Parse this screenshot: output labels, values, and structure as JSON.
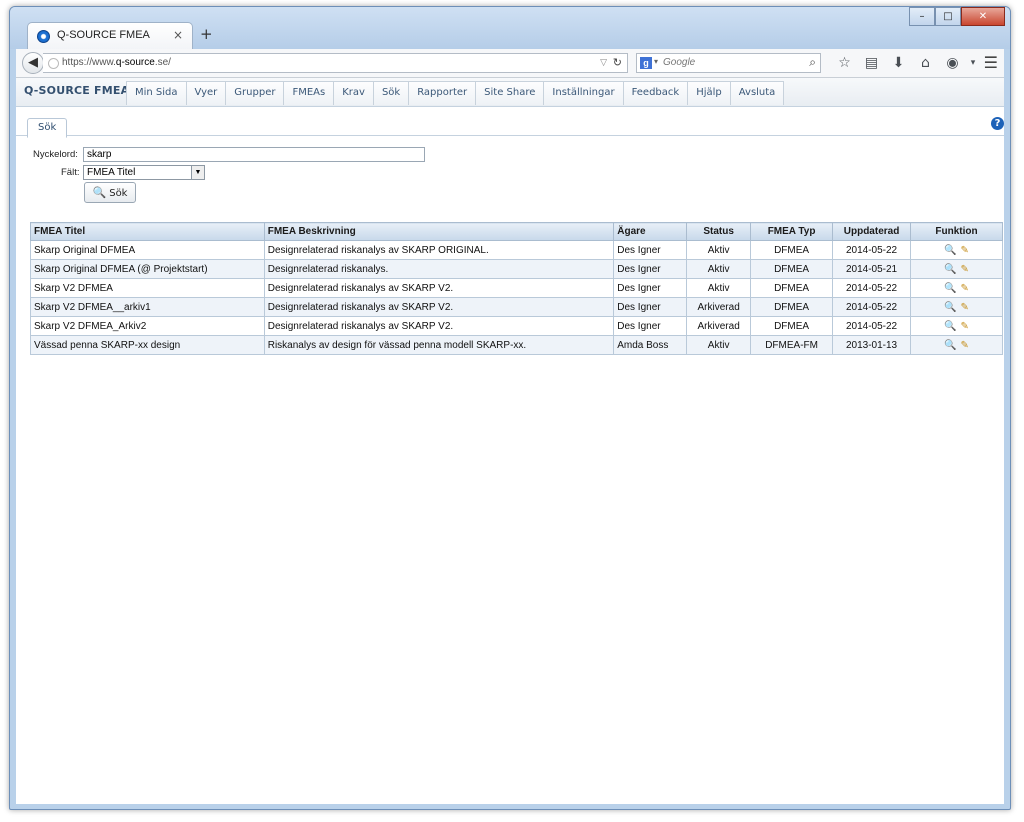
{
  "browser": {
    "tab_title": "Q-SOURCE FMEA",
    "tab_close": "×",
    "new_tab": "+",
    "win_min": "–",
    "win_max": "□",
    "win_close": "✕",
    "url_prefix": "https://www.",
    "url_domain": "q-source",
    "url_suffix": ".se/",
    "search_placeholder": "Google",
    "icons": [
      "star-icon",
      "clipboard-icon",
      "download-icon",
      "home-icon",
      "sync-icon",
      "menu-icon"
    ]
  },
  "app": {
    "brand": "Q-SOURCE FMEA",
    "nav": [
      "Min Sida",
      "Vyer",
      "Grupper",
      "FMEAs",
      "Krav",
      "Sök",
      "Rapporter",
      "Site Share",
      "Inställningar",
      "Feedback",
      "Hjälp",
      "Avsluta"
    ],
    "subtab": "Sök"
  },
  "search_form": {
    "keyword_label": "Nyckelord:",
    "keyword_value": "skarp",
    "field_label": "Fält:",
    "field_value": "FMEA Titel",
    "button_label": "Sök"
  },
  "table": {
    "headers": [
      "FMEA Titel",
      "FMEA Beskrivning",
      "Ägare",
      "Status",
      "FMEA Typ",
      "Uppdaterad",
      "Funktion"
    ],
    "rows": [
      {
        "title": "Skarp Original DFMEA",
        "desc": "Designrelaterad riskanalys av SKARP ORIGINAL.",
        "owner": "Des Igner",
        "status": "Aktiv",
        "type": "DFMEA",
        "updated": "2014-05-22"
      },
      {
        "title": "Skarp Original DFMEA (@ Projektstart)",
        "desc": "Designrelaterad riskanalys.",
        "owner": "Des Igner",
        "status": "Aktiv",
        "type": "DFMEA",
        "updated": "2014-05-21"
      },
      {
        "title": "Skarp V2 DFMEA",
        "desc": "Designrelaterad riskanalys av SKARP V2.",
        "owner": "Des Igner",
        "status": "Aktiv",
        "type": "DFMEA",
        "updated": "2014-05-22"
      },
      {
        "title": "Skarp V2 DFMEA__arkiv1",
        "desc": "Designrelaterad riskanalys av SKARP V2.",
        "owner": "Des Igner",
        "status": "Arkiverad",
        "type": "DFMEA",
        "updated": "2014-05-22"
      },
      {
        "title": "Skarp V2 DFMEA_Arkiv2",
        "desc": "Designrelaterad riskanalys av SKARP V2.",
        "owner": "Des Igner",
        "status": "Arkiverad",
        "type": "DFMEA",
        "updated": "2014-05-22"
      },
      {
        "title": "Vässad penna SKARP-xx design",
        "desc": "Riskanalys av design för vässad penna modell SKARP-xx.",
        "owner": "Amda Boss",
        "status": "Aktiv",
        "type": "DFMEA-FM",
        "updated": "2013-01-13"
      }
    ]
  },
  "colors": {
    "link": "#2a4fb8",
    "header_bg": "#c7d8ea",
    "row_alt": "#eef3f9",
    "brand": "#34506f"
  }
}
